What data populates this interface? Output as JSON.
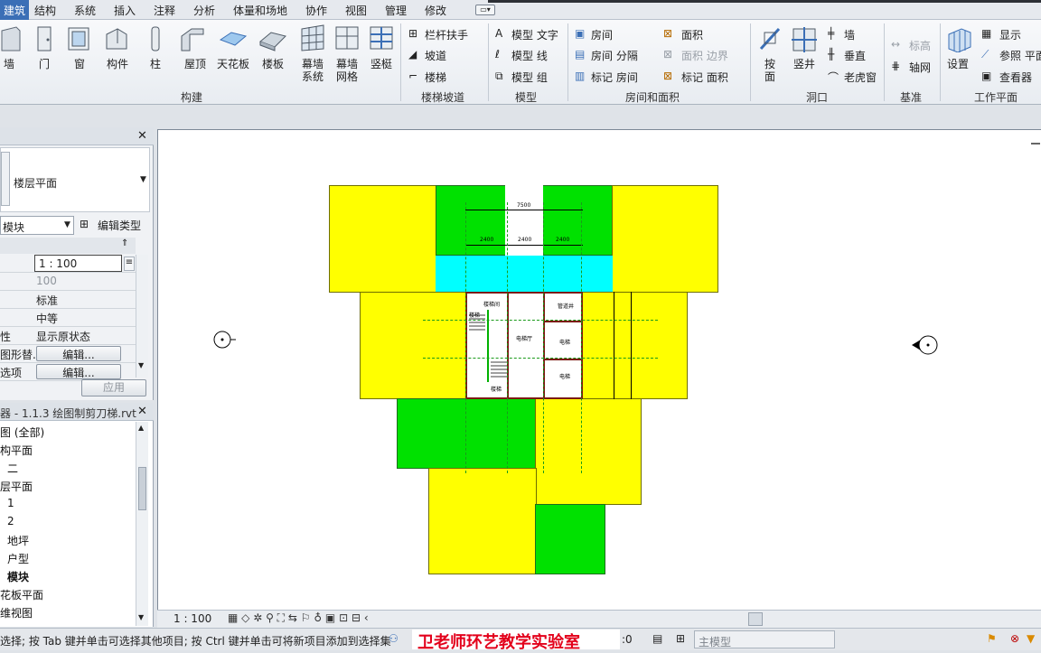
{
  "menu": {
    "items": [
      "建筑",
      "结构",
      "系统",
      "插入",
      "注释",
      "分析",
      "体量和场地",
      "协作",
      "视图",
      "管理",
      "修改"
    ],
    "active": "建筑"
  },
  "ribbon": {
    "build": [
      "墙",
      "门",
      "窗",
      "构件",
      "柱",
      "屋顶",
      "天花板",
      "楼板",
      "幕墙\n系统",
      "幕墙\n网格",
      "竖梃"
    ],
    "build_title": "构建",
    "stairs": [
      "栏杆扶手",
      "坡道",
      "楼梯"
    ],
    "stairs_title": "楼梯坡道",
    "model": [
      "模型 文字",
      "模型 线",
      "模型 组"
    ],
    "model_title": "模型",
    "room": [
      "房间",
      "房间 分隔",
      "标记 房间",
      "面积",
      "面积 边界",
      "标记 面积"
    ],
    "room_title": "房间和面积",
    "opening": [
      "按\n面",
      "竖井",
      "墙",
      "垂直",
      "老虎窗"
    ],
    "opening_title": "洞口",
    "datum": [
      "标高",
      "轴网"
    ],
    "datum_title": "基准",
    "workplane": [
      "设置",
      "显示",
      "参照 平面",
      "查看器"
    ],
    "workplane_title": "工作平面"
  },
  "properties": {
    "type_label": "楼层平面",
    "instance_selector": "模块",
    "edit_type": "编辑类型",
    "rows": [
      {
        "label": "",
        "value": "1 : 100"
      },
      {
        "label": "",
        "value": "100"
      },
      {
        "label": "",
        "value": "标准"
      },
      {
        "label": "",
        "value": "中等"
      },
      {
        "label": "性",
        "value": "显示原状态"
      },
      {
        "label": "图形替...",
        "value": "编辑..."
      },
      {
        "label": "选项",
        "value": "编辑..."
      }
    ],
    "apply": "应用"
  },
  "browser": {
    "title": "器 - 1.1.3 绘图制剪刀梯.rvt",
    "items": [
      "图 (全部)",
      "构平面",
      "二",
      "层平面",
      "1",
      "2",
      "地坪",
      "户型",
      "模块",
      "花板平面",
      "维视图"
    ]
  },
  "drawing": {
    "labels": [
      "楼梯间",
      "电梯厅",
      "管道井",
      "电梯",
      "电梯",
      "楼梯",
      "楼梯"
    ],
    "dims": [
      "7500",
      "2400",
      "2400",
      "2400"
    ]
  },
  "viewbar": {
    "scale": "1 : 100"
  },
  "status": {
    "hint": "选择; 按 Tab 键并单击可选择其他项目; 按 Ctrl 键并单击可将新项目添加到选择集",
    "watermark": "卫老师环艺教学实验室",
    "count": ":0",
    "model": "主模型"
  },
  "colors": {
    "accent": "#3b6fb6",
    "yellow": "#ffff00",
    "green": "#00e100",
    "cyan": "#00ffff"
  }
}
